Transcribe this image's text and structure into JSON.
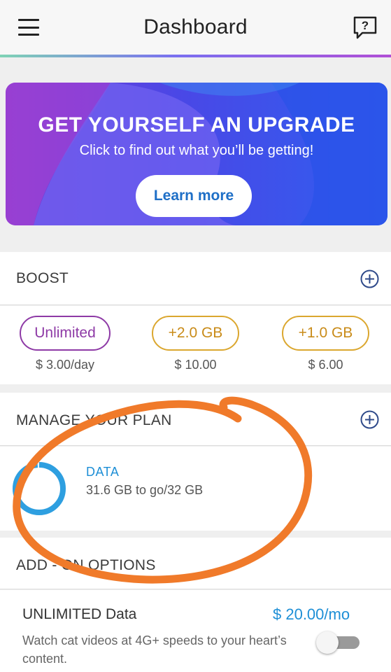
{
  "header": {
    "title": "Dashboard",
    "menu_icon": "hamburger-menu-icon",
    "help_icon": "help-question-icon"
  },
  "banner": {
    "headline": "GET YOURSELF AN UPGRADE",
    "subtitle": "Click to find out what you’ll be getting!",
    "cta_label": "Learn more"
  },
  "boost": {
    "title": "BOOST",
    "options": [
      {
        "label": "Unlimited",
        "price": "$ 3.00/day",
        "color": "#8e3aa6"
      },
      {
        "label": "+2.0 GB",
        "price": "$ 10.00",
        "color": "#dba72f"
      },
      {
        "label": "+1.0 GB",
        "price": "$ 6.00",
        "color": "#dba72f"
      }
    ]
  },
  "plan": {
    "title": "MANAGE YOUR PLAN",
    "data_label": "DATA",
    "data_usage": "31.6 GB to go/32 GB",
    "remaining_fraction": 0.9875
  },
  "addons": {
    "title": "ADD - ON OPTIONS",
    "items": [
      {
        "name": "UNLIMITED Data",
        "price": "$ 20.00/mo",
        "description": "Watch cat videos at 4G+ speeds to your heart’s content.",
        "enabled": false
      }
    ]
  },
  "colors": {
    "accent_blue": "#1e8fd6",
    "boost_purple": "#8e3aa6",
    "boost_gold": "#dba72f",
    "annotation_orange": "#f07a2a"
  }
}
